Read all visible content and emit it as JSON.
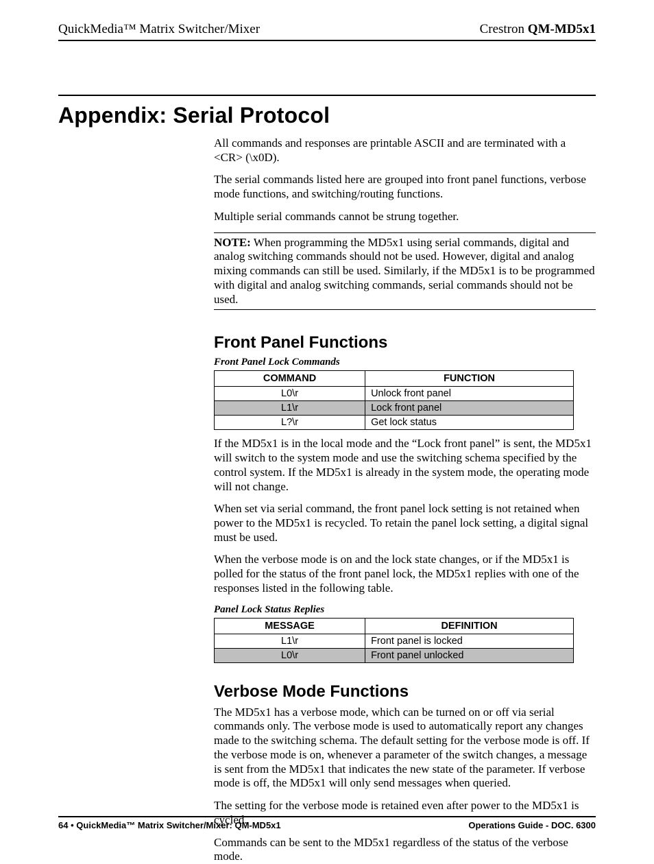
{
  "header": {
    "left": "QuickMedia™ Matrix Switcher/Mixer",
    "right_prefix": "Crestron ",
    "right_bold": "QM-MD5x1"
  },
  "section_title": "Appendix: Serial Protocol",
  "intro": {
    "p1": "All commands and responses are printable ASCII and are terminated with a <CR> (\\x0D).",
    "p2": "The serial commands listed here are grouped into front panel functions, verbose mode functions, and switching/routing functions.",
    "p3": "Multiple serial commands cannot be strung together."
  },
  "note": {
    "label": "NOTE:",
    "text": "  When programming the MD5x1 using serial commands, digital and analog switching commands should not be used. However, digital and analog mixing commands can still be used. Similarly, if the MD5x1 is to be programmed with digital and analog switching commands, serial commands should not be used."
  },
  "front_panel": {
    "heading": "Front Panel Functions",
    "table1": {
      "caption": "Front Panel Lock Commands",
      "col1": "COMMAND",
      "col2": "FUNCTION",
      "rows": [
        {
          "cmd": "L0\\r",
          "fn": "Unlock front panel"
        },
        {
          "cmd": "L1\\r",
          "fn": "Lock front panel"
        },
        {
          "cmd": "L?\\r",
          "fn": "Get lock status"
        }
      ]
    },
    "p1": "If the MD5x1 is in the local mode and the “Lock front panel” is sent, the MD5x1 will switch to the system mode and use the switching schema specified by the control system. If the MD5x1 is already in the system mode, the operating mode will not change.",
    "p2": "When set via serial command, the front panel lock setting is not retained when power to the MD5x1 is recycled. To retain the panel lock setting, a digital signal must be used.",
    "p3": "When the verbose mode is on and the lock state changes, or if the MD5x1 is polled for the status of the front panel lock, the MD5x1 replies with one of the responses listed in the following table.",
    "table2": {
      "caption": "Panel Lock Status Replies",
      "col1": "MESSAGE",
      "col2": "DEFINITION",
      "rows": [
        {
          "cmd": "L1\\r",
          "fn": "Front panel is locked"
        },
        {
          "cmd": "L0\\r",
          "fn": "Front panel unlocked"
        }
      ]
    }
  },
  "verbose": {
    "heading": "Verbose Mode Functions",
    "p1": "The MD5x1 has a verbose mode, which can be turned on or off via serial commands only. The verbose mode is used to automatically report any changes made to the switching schema. The default setting for the verbose mode is off. If the verbose mode is on, whenever a parameter of the switch changes, a message is sent from the MD5x1 that indicates the new state of the parameter. If verbose mode is off, the MD5x1 will only send messages when queried.",
    "p2": "The setting for the verbose mode is retained even after power to the MD5x1 is cycled.",
    "p3": "Commands can be sent to the MD5x1 regardless of the status of the verbose mode."
  },
  "footer": {
    "page_no": "64",
    "bullet": "•",
    "left_text": "QuickMedia™ Matrix Switcher/Mixer: QM-MD5x1",
    "right_text": "Operations Guide - DOC. 6300"
  }
}
